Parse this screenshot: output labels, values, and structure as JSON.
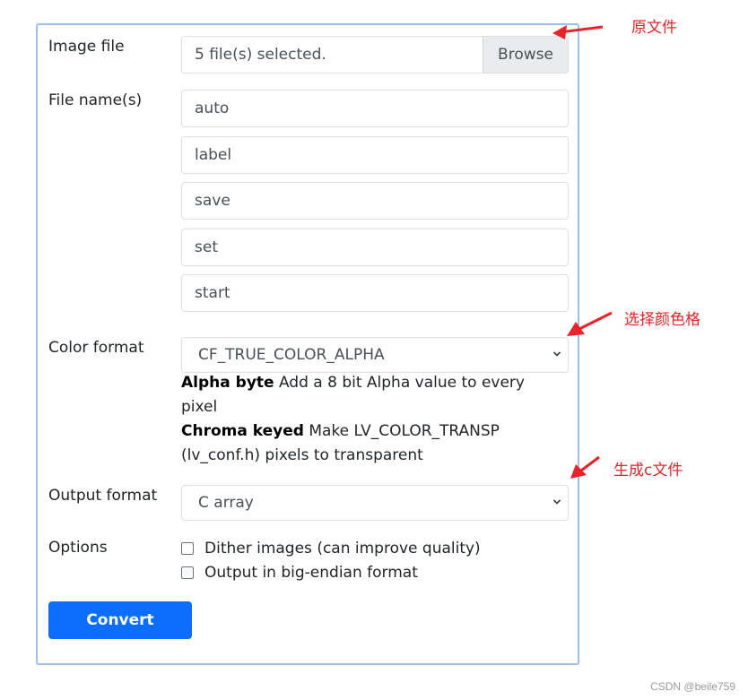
{
  "form": {
    "image_file_label": "Image file",
    "file_status": "5 file(s) selected.",
    "browse_label": "Browse",
    "file_names_label": "File name(s)",
    "file_names": [
      "auto",
      "label",
      "save",
      "set",
      "start"
    ],
    "color_format_label": "Color format",
    "color_format_value": "CF_TRUE_COLOR_ALPHA",
    "color_desc": {
      "alpha_title": "Alpha byte",
      "alpha_text": "Add a 8 bit Alpha value to every pixel",
      "chroma_title": "Chroma keyed",
      "chroma_text": "Make LV_COLOR_TRANSP (lv_conf.h) pixels to transparent"
    },
    "output_format_label": "Output format",
    "output_format_value": "C array",
    "options_label": "Options",
    "option_dither": "Dither images (can improve quality)",
    "option_bigendian": "Output in big-endian format",
    "convert_label": "Convert"
  },
  "annotations": {
    "source_file": "原文件",
    "choose_color": "选择颜色格",
    "generate_c": "生成c文件",
    "color": "#e8232a"
  },
  "watermark": "CSDN @beile759",
  "colors": {
    "accent": "#0d6efd",
    "border": "#9fc0e6"
  }
}
